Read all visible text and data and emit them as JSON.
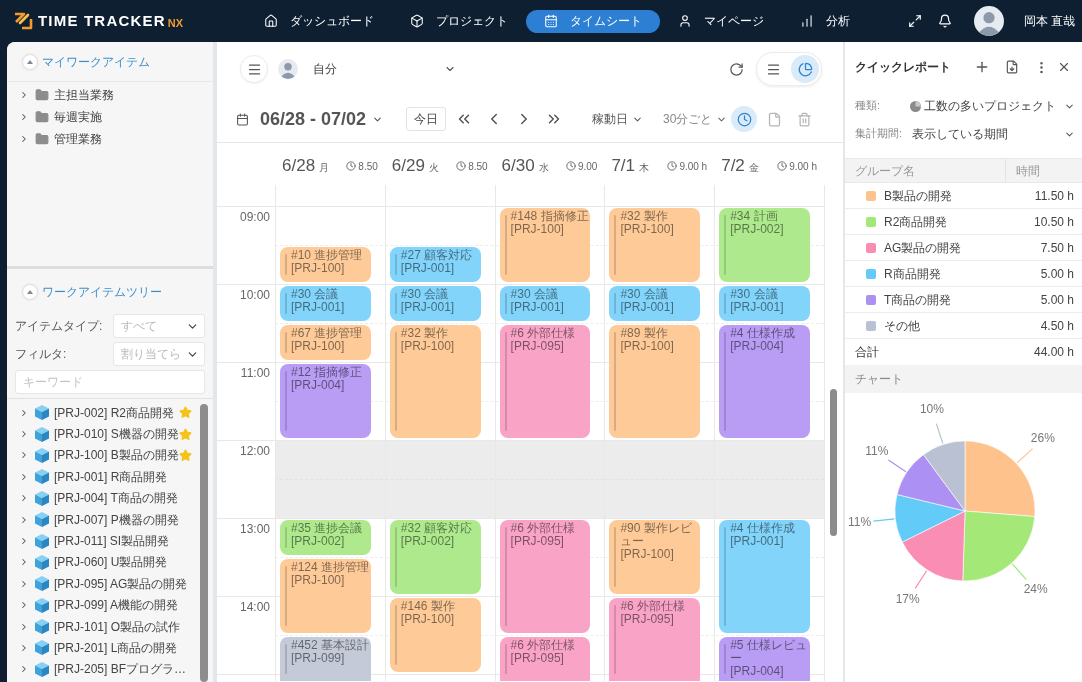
{
  "header": {
    "logo": {
      "text": "TIME TRACKER",
      "suffix": "NX"
    },
    "nav": [
      {
        "kind": "home",
        "label": "ダッシュボード",
        "selected": false
      },
      {
        "kind": "project",
        "label": "プロジェクト",
        "selected": false
      },
      {
        "kind": "timesheet",
        "label": "タイムシート",
        "selected": true
      },
      {
        "kind": "user",
        "label": "マイページ",
        "selected": false
      },
      {
        "kind": "analytics",
        "label": "分析",
        "selected": false
      }
    ],
    "user_name": "岡本 直哉"
  },
  "sidebar": {
    "my_work_items": {
      "title": "マイワークアイテム",
      "expanded": true,
      "items": [
        {
          "label": "主担当業務",
          "expanded": false
        },
        {
          "label": "毎週実施",
          "expanded": false
        },
        {
          "label": "管理業務",
          "expanded": false
        }
      ]
    },
    "work_item_tree": {
      "title": "ワークアイテムツリー",
      "expanded": true,
      "filters": [
        {
          "label": "アイテムタイプ:",
          "value": "すべて"
        },
        {
          "label": "フィルタ:",
          "value": "割り当てら"
        }
      ],
      "keyword": {
        "placeholder": "キーワード"
      },
      "items": [
        {
          "label": "[PRJ-002] R2商品開発",
          "starred": true,
          "expanded": false
        },
        {
          "label": "[PRJ-010] S機器の開発",
          "starred": true,
          "expanded": false
        },
        {
          "label": "[PRJ-100] B製品の開発",
          "starred": true,
          "expanded": false
        },
        {
          "label": "[PRJ-001] R商品開発",
          "starred": false,
          "expanded": false
        },
        {
          "label": "[PRJ-004] T商品の開発",
          "starred": false,
          "expanded": false
        },
        {
          "label": "[PRJ-007] P機器の開発",
          "starred": false,
          "expanded": false
        },
        {
          "label": "[PRJ-011] SI製品開発",
          "starred": false,
          "expanded": false
        },
        {
          "label": "[PRJ-060] U製品開発",
          "starred": false,
          "expanded": false
        },
        {
          "label": "[PRJ-095] AG製品の開発",
          "starred": false,
          "expanded": false
        },
        {
          "label": "[PRJ-099] A機能の開発",
          "starred": false,
          "expanded": false
        },
        {
          "label": "[PRJ-101] O製品の試作",
          "starred": false,
          "expanded": false
        },
        {
          "label": "[PRJ-201] L商品の開発",
          "starred": false,
          "expanded": false
        },
        {
          "label": "[PRJ-205] BFプログラ…",
          "starred": false,
          "expanded": false
        }
      ]
    }
  },
  "timesheet": {
    "toolbar": {
      "member": "自分",
      "views": [
        {
          "kind": "list",
          "selected": false
        },
        {
          "kind": "chart",
          "selected": true
        }
      ],
      "range": "06/28 - 07/02",
      "today": "今日",
      "day_mode": "稼動日",
      "interval": "30分ごと",
      "tools": [
        {
          "kind": "clock",
          "selected": true
        },
        {
          "kind": "document",
          "selected": false
        },
        {
          "kind": "trash",
          "selected": false
        }
      ]
    },
    "hours": [
      {
        "label": "09:00",
        "break": false
      },
      {
        "label": "10:00",
        "break": false
      },
      {
        "label": "11:00",
        "break": false
      },
      {
        "label": "12:00",
        "break": true
      },
      {
        "label": "13:00",
        "break": false
      },
      {
        "label": "14:00",
        "break": false
      }
    ],
    "days": [
      {
        "date": "6/28",
        "weekday": "月",
        "hours": "8.50",
        "events": [
          {
            "title": "#10 進捗管理",
            "project": "[PRJ-100]",
            "color": "#fdca98"
          },
          {
            "title": "#30 会議",
            "project": "[PRJ-001]",
            "color": "#82d4fb"
          },
          {
            "title": "#67 進捗管理",
            "project": "[PRJ-100]",
            "color": "#fdca98"
          },
          {
            "title": "#12 指摘修正",
            "project": "[PRJ-004]",
            "color": "#b99df5"
          },
          {
            "title": "#35 進捗会議",
            "project": "[PRJ-002]",
            "color": "#aeea8d"
          },
          {
            "title": "#124 進捗管理",
            "project": "[PRJ-100]",
            "color": "#fdca98"
          },
          {
            "title": "#452 基本設計",
            "project": "[PRJ-099]",
            "color": "#c5cad8"
          }
        ]
      },
      {
        "date": "6/29",
        "weekday": "火",
        "hours": "8.50",
        "events": [
          {
            "title": "#27 顧客対応",
            "project": "[PRJ-001]",
            "color": "#82d4fb"
          },
          {
            "title": "#30 会議",
            "project": "[PRJ-001]",
            "color": "#82d4fb"
          },
          {
            "title": "#32 製作",
            "project": "[PRJ-100]",
            "color": "#fdca98"
          },
          {
            "title": "#32 顧客対応",
            "project": "[PRJ-002]",
            "color": "#aeea8d"
          },
          {
            "title": "#146 製作",
            "project": "[PRJ-100]",
            "color": "#fdca98"
          }
        ]
      },
      {
        "date": "6/30",
        "weekday": "水",
        "hours": "9.00",
        "events": [
          {
            "title": "#148 指摘修正",
            "project": "[PRJ-100]",
            "color": "#fdca98"
          },
          {
            "title": "#30 会議",
            "project": "[PRJ-001]",
            "color": "#82d4fb"
          },
          {
            "title": "#6 外部仕様",
            "project": "[PRJ-095]",
            "color": "#f9a3c6"
          },
          {
            "title": "#6 外部仕様",
            "project": "[PRJ-095]",
            "color": "#f9a3c6"
          },
          {
            "title": "#6 外部仕様",
            "project": "[PRJ-095]",
            "color": "#f9a3c6"
          }
        ]
      },
      {
        "date": "7/1",
        "weekday": "木",
        "hours": "9.00 h",
        "events": [
          {
            "title": "#32 製作",
            "project": "[PRJ-100]",
            "color": "#fdca98"
          },
          {
            "title": "#30 会議",
            "project": "[PRJ-001]",
            "color": "#82d4fb"
          },
          {
            "title": "#89 製作",
            "project": "[PRJ-100]",
            "color": "#fdca98"
          },
          {
            "title": "#90 製作レビュー",
            "project": "[PRJ-100]",
            "color": "#fdca98"
          },
          {
            "title": "#6 外部仕様",
            "project": "[PRJ-095]",
            "color": "#f9a3c6"
          }
        ]
      },
      {
        "date": "7/2",
        "weekday": "金",
        "hours": "9.00 h",
        "events": [
          {
            "title": "#34 計画",
            "project": "[PRJ-002]",
            "color": "#aeea8d"
          },
          {
            "title": "#30 会議",
            "project": "[PRJ-001]",
            "color": "#82d4fb"
          },
          {
            "title": "#4 仕様作成",
            "project": "[PRJ-004]",
            "color": "#b99df5"
          },
          {
            "title": "#4 仕様作成",
            "project": "[PRJ-001]",
            "color": "#82d4fb"
          },
          {
            "title": "#5 仕様レビュー",
            "project": "[PRJ-004]",
            "color": "#b99df5"
          }
        ]
      }
    ]
  },
  "quick_report": {
    "title": "クイックレポート",
    "type": {
      "label": "種類:",
      "value": "工数の多いプロジェクト"
    },
    "period": {
      "label": "集計期間:",
      "value": "表示している期間"
    },
    "columns": [
      "グループ名",
      "時間"
    ],
    "rows": [
      {
        "name": "B製品の開発",
        "hours": "11.50 h",
        "color": "#fec28d"
      },
      {
        "name": "R2商品開発",
        "hours": "10.50 h",
        "color": "#a4e878"
      },
      {
        "name": "AG製品の開発",
        "hours": "7.50 h",
        "color": "#f98db3"
      },
      {
        "name": "R商品開発",
        "hours": "5.00 h",
        "color": "#62cbf8"
      },
      {
        "name": "T商品の開発",
        "hours": "5.00 h",
        "color": "#ad90f3"
      },
      {
        "name": "その他",
        "hours": "4.50 h",
        "color": "#b9c1d3"
      }
    ],
    "total": {
      "label": "合計",
      "hours": "44.00 h"
    },
    "chart": {
      "title": "チャート",
      "chart_data": {
        "type": "pie",
        "values": [
          26,
          24,
          17,
          11,
          11,
          10
        ],
        "value_labels": [
          "26%",
          "24%",
          "17%",
          "11%",
          "11%",
          "10%"
        ]
      }
    }
  }
}
